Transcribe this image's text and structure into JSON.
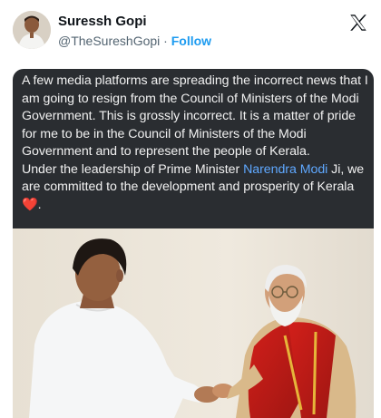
{
  "author": {
    "name": "Suressh Gopi",
    "handle": "@TheSureshGopi",
    "separator": "·",
    "follow_label": "Follow"
  },
  "post": {
    "text_part1": "A few media platforms are spreading the incorrect news that I am going to resign from the Council of Ministers of the Modi Government. This is grossly incorrect. It is a matter of pride for me to be in the Council of Ministers of the Modi Government and to represent the people of Kerala.",
    "text_part2": "Under the leadership of Prime Minister ",
    "link_text": "Narendra Modi",
    "text_part3": " Ji, we are committed to the development and prosperity of Kerala ",
    "emoji": "❤️",
    "text_end": "."
  },
  "icons": {
    "platform": "x-logo-icon",
    "reaction": "red-heart-icon"
  },
  "colors": {
    "accent": "#1d9bf0",
    "panel_bg": "#2a2d31",
    "panel_text": "#f1f1f1",
    "mention": "#5fa8ff"
  }
}
